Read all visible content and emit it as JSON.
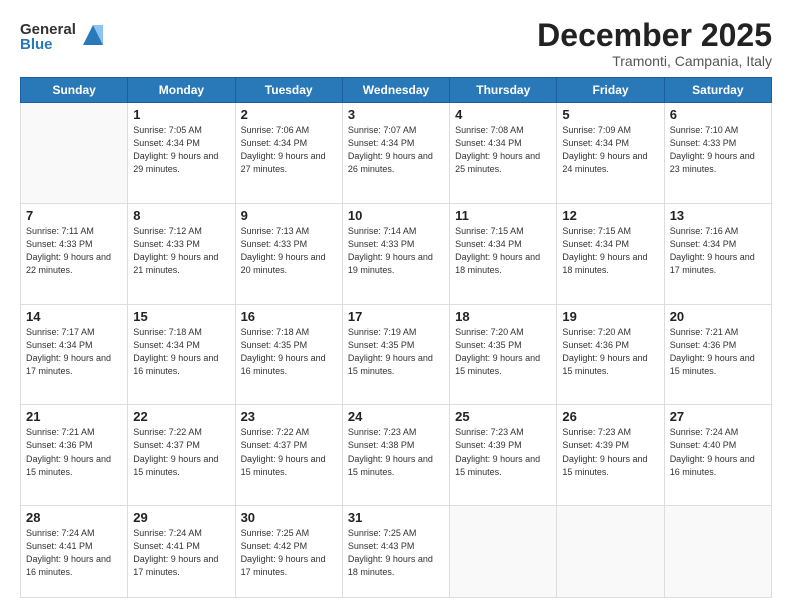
{
  "logo": {
    "general": "General",
    "blue": "Blue"
  },
  "title": "December 2025",
  "subtitle": "Tramonti, Campania, Italy",
  "days_of_week": [
    "Sunday",
    "Monday",
    "Tuesday",
    "Wednesday",
    "Thursday",
    "Friday",
    "Saturday"
  ],
  "weeks": [
    [
      {
        "day": "",
        "info": ""
      },
      {
        "day": "1",
        "info": "Sunrise: 7:05 AM\nSunset: 4:34 PM\nDaylight: 9 hours\nand 29 minutes."
      },
      {
        "day": "2",
        "info": "Sunrise: 7:06 AM\nSunset: 4:34 PM\nDaylight: 9 hours\nand 27 minutes."
      },
      {
        "day": "3",
        "info": "Sunrise: 7:07 AM\nSunset: 4:34 PM\nDaylight: 9 hours\nand 26 minutes."
      },
      {
        "day": "4",
        "info": "Sunrise: 7:08 AM\nSunset: 4:34 PM\nDaylight: 9 hours\nand 25 minutes."
      },
      {
        "day": "5",
        "info": "Sunrise: 7:09 AM\nSunset: 4:34 PM\nDaylight: 9 hours\nand 24 minutes."
      },
      {
        "day": "6",
        "info": "Sunrise: 7:10 AM\nSunset: 4:33 PM\nDaylight: 9 hours\nand 23 minutes."
      }
    ],
    [
      {
        "day": "7",
        "info": "Sunrise: 7:11 AM\nSunset: 4:33 PM\nDaylight: 9 hours\nand 22 minutes."
      },
      {
        "day": "8",
        "info": "Sunrise: 7:12 AM\nSunset: 4:33 PM\nDaylight: 9 hours\nand 21 minutes."
      },
      {
        "day": "9",
        "info": "Sunrise: 7:13 AM\nSunset: 4:33 PM\nDaylight: 9 hours\nand 20 minutes."
      },
      {
        "day": "10",
        "info": "Sunrise: 7:14 AM\nSunset: 4:33 PM\nDaylight: 9 hours\nand 19 minutes."
      },
      {
        "day": "11",
        "info": "Sunrise: 7:15 AM\nSunset: 4:34 PM\nDaylight: 9 hours\nand 18 minutes."
      },
      {
        "day": "12",
        "info": "Sunrise: 7:15 AM\nSunset: 4:34 PM\nDaylight: 9 hours\nand 18 minutes."
      },
      {
        "day": "13",
        "info": "Sunrise: 7:16 AM\nSunset: 4:34 PM\nDaylight: 9 hours\nand 17 minutes."
      }
    ],
    [
      {
        "day": "14",
        "info": "Sunrise: 7:17 AM\nSunset: 4:34 PM\nDaylight: 9 hours\nand 17 minutes."
      },
      {
        "day": "15",
        "info": "Sunrise: 7:18 AM\nSunset: 4:34 PM\nDaylight: 9 hours\nand 16 minutes."
      },
      {
        "day": "16",
        "info": "Sunrise: 7:18 AM\nSunset: 4:35 PM\nDaylight: 9 hours\nand 16 minutes."
      },
      {
        "day": "17",
        "info": "Sunrise: 7:19 AM\nSunset: 4:35 PM\nDaylight: 9 hours\nand 15 minutes."
      },
      {
        "day": "18",
        "info": "Sunrise: 7:20 AM\nSunset: 4:35 PM\nDaylight: 9 hours\nand 15 minutes."
      },
      {
        "day": "19",
        "info": "Sunrise: 7:20 AM\nSunset: 4:36 PM\nDaylight: 9 hours\nand 15 minutes."
      },
      {
        "day": "20",
        "info": "Sunrise: 7:21 AM\nSunset: 4:36 PM\nDaylight: 9 hours\nand 15 minutes."
      }
    ],
    [
      {
        "day": "21",
        "info": "Sunrise: 7:21 AM\nSunset: 4:36 PM\nDaylight: 9 hours\nand 15 minutes."
      },
      {
        "day": "22",
        "info": "Sunrise: 7:22 AM\nSunset: 4:37 PM\nDaylight: 9 hours\nand 15 minutes."
      },
      {
        "day": "23",
        "info": "Sunrise: 7:22 AM\nSunset: 4:37 PM\nDaylight: 9 hours\nand 15 minutes."
      },
      {
        "day": "24",
        "info": "Sunrise: 7:23 AM\nSunset: 4:38 PM\nDaylight: 9 hours\nand 15 minutes."
      },
      {
        "day": "25",
        "info": "Sunrise: 7:23 AM\nSunset: 4:39 PM\nDaylight: 9 hours\nand 15 minutes."
      },
      {
        "day": "26",
        "info": "Sunrise: 7:23 AM\nSunset: 4:39 PM\nDaylight: 9 hours\nand 15 minutes."
      },
      {
        "day": "27",
        "info": "Sunrise: 7:24 AM\nSunset: 4:40 PM\nDaylight: 9 hours\nand 16 minutes."
      }
    ],
    [
      {
        "day": "28",
        "info": "Sunrise: 7:24 AM\nSunset: 4:41 PM\nDaylight: 9 hours\nand 16 minutes."
      },
      {
        "day": "29",
        "info": "Sunrise: 7:24 AM\nSunset: 4:41 PM\nDaylight: 9 hours\nand 17 minutes."
      },
      {
        "day": "30",
        "info": "Sunrise: 7:25 AM\nSunset: 4:42 PM\nDaylight: 9 hours\nand 17 minutes."
      },
      {
        "day": "31",
        "info": "Sunrise: 7:25 AM\nSunset: 4:43 PM\nDaylight: 9 hours\nand 18 minutes."
      },
      {
        "day": "",
        "info": ""
      },
      {
        "day": "",
        "info": ""
      },
      {
        "day": "",
        "info": ""
      }
    ]
  ]
}
